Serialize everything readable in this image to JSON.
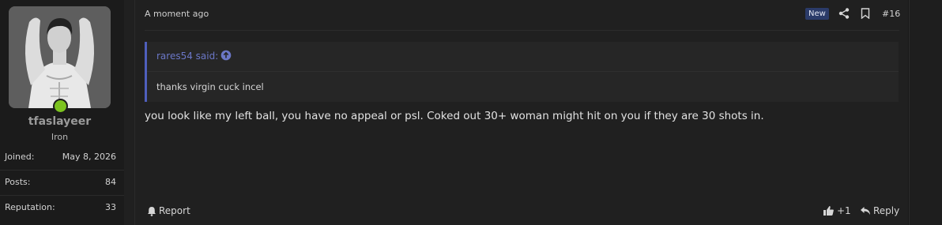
{
  "user": {
    "name": "tfaslayeer",
    "title": "Iron",
    "status": "online",
    "stats": [
      {
        "label": "Joined:",
        "value": "May 8, 2026"
      },
      {
        "label": "Posts:",
        "value": "84"
      },
      {
        "label": "Reputation:",
        "value": "33"
      }
    ]
  },
  "post": {
    "date": "A moment ago",
    "badge": "New",
    "number": "#16",
    "quote": {
      "author": "rares54 said:",
      "text": "thanks virgin cuck incel"
    },
    "body": "you look like my left ball, you have no appeal or psl. Coked out 30+ woman might hit on you if they are 30 shots in."
  },
  "actions": {
    "report_label": "Report",
    "reaction_count": "+1",
    "reply_label": "Reply"
  },
  "icons": [
    "share-icon",
    "bookmark-icon",
    "arrow-up-circle-icon",
    "bell-icon",
    "thumbs-up-icon",
    "reply-icon"
  ],
  "colors": {
    "accent": "#6b77c7",
    "online": "#7cc31f",
    "badge_bg": "#2b3b69"
  }
}
